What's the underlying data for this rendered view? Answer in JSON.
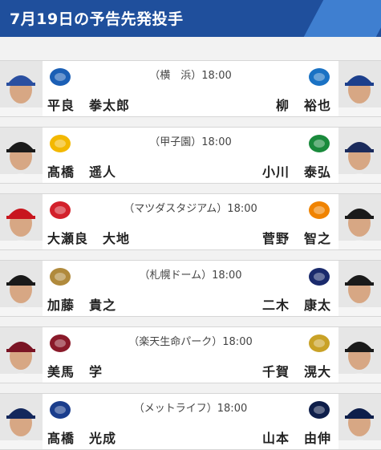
{
  "header": {
    "title": "7月19日の予告先発投手",
    "bg_color": "#1f4f9c",
    "accent_color": "#3f7fd0"
  },
  "games": [
    {
      "venue": "（横　浜）18:00",
      "left": {
        "last": "平良",
        "first": "拳太郎",
        "logo_color": "#1b5fb5",
        "logo_icon": "baystars-logo-icon",
        "cap_color": "#2a4fa0"
      },
      "right": {
        "last": "柳",
        "first": "裕也",
        "logo_color": "#1a72c4",
        "logo_icon": "dragons-logo-icon",
        "cap_color": "#1c3f8c"
      }
    },
    {
      "venue": "（甲子園）18:00",
      "left": {
        "last": "髙橋",
        "first": "遥人",
        "logo_color": "#f3b800",
        "logo_icon": "tigers-logo-icon",
        "cap_color": "#1a1a1a"
      },
      "right": {
        "last": "小川",
        "first": "泰弘",
        "logo_color": "#1a8a3c",
        "logo_icon": "swallows-logo-icon",
        "cap_color": "#1b2b5c"
      }
    },
    {
      "venue": "（マツダスタジアム）18:00",
      "left": {
        "last": "大瀬良",
        "first": "大地",
        "logo_color": "#d3202b",
        "logo_icon": "carp-logo-icon",
        "cap_color": "#c8161e"
      },
      "right": {
        "last": "菅野",
        "first": "智之",
        "logo_color": "#f08300",
        "logo_icon": "giants-logo-icon",
        "cap_color": "#1a1a1a"
      }
    },
    {
      "venue": "（札幌ドーム）18:00",
      "left": {
        "last": "加藤",
        "first": "貴之",
        "logo_color": "#b08a3c",
        "logo_icon": "fighters-logo-icon",
        "cap_color": "#1a1a1a"
      },
      "right": {
        "last": "二木",
        "first": "康太",
        "logo_color": "#1a2a6c",
        "logo_icon": "marines-logo-icon",
        "cap_color": "#1a1a1a"
      }
    },
    {
      "venue": "（楽天生命パーク）18:00",
      "left": {
        "last": "美馬",
        "first": "学",
        "logo_color": "#8a1a2a",
        "logo_icon": "eagles-logo-icon",
        "cap_color": "#7a1424"
      },
      "right": {
        "last": "千賀",
        "first": "滉大",
        "logo_color": "#c9a227",
        "logo_icon": "hawks-logo-icon",
        "cap_color": "#1a1a1a"
      }
    },
    {
      "venue": "（メットライフ）18:00",
      "left": {
        "last": "髙橋",
        "first": "光成",
        "logo_color": "#1a3d8c",
        "logo_icon": "lions-logo-icon",
        "cap_color": "#14285c"
      },
      "right": {
        "last": "山本",
        "first": "由伸",
        "logo_color": "#0e1e4a",
        "logo_icon": "buffaloes-logo-icon",
        "cap_color": "#0e1e4a"
      }
    }
  ]
}
